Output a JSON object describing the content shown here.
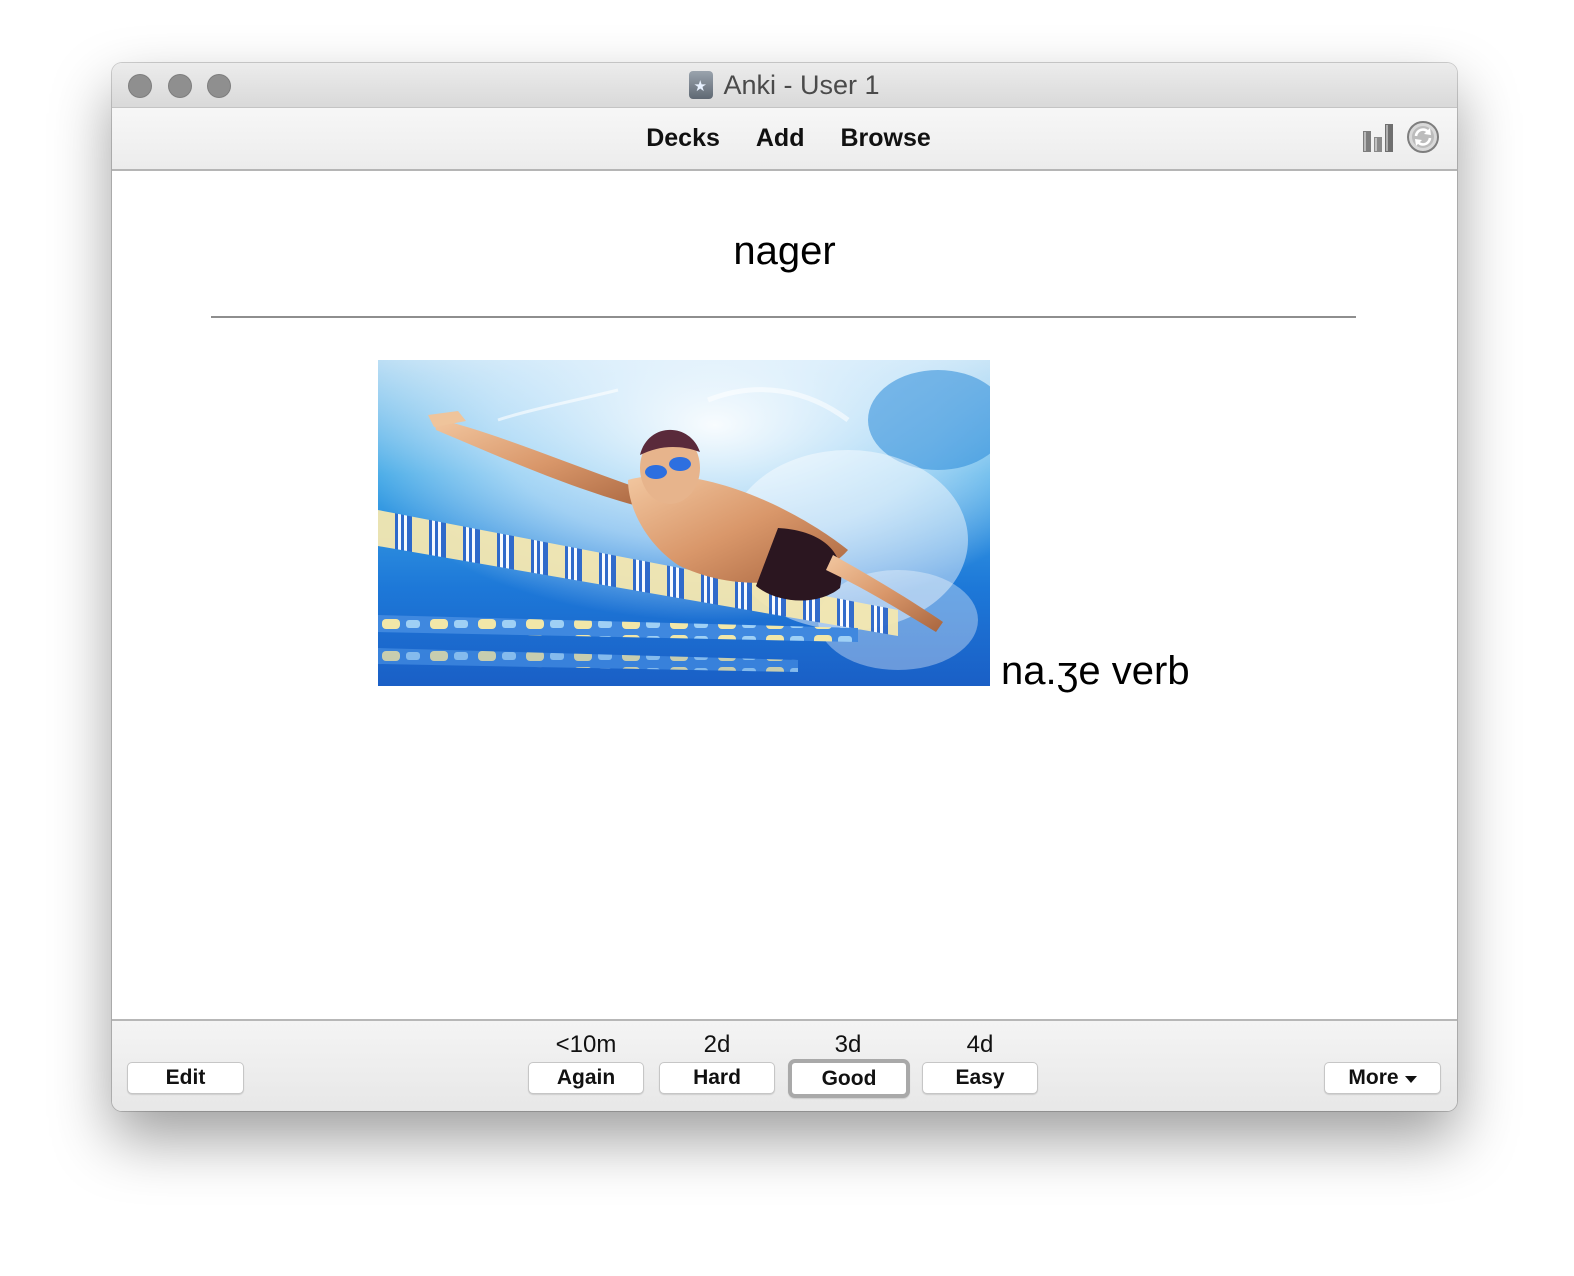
{
  "window": {
    "title": "Anki - User 1"
  },
  "toolbar": {
    "links": {
      "decks": "Decks",
      "add": "Add",
      "browse": "Browse"
    },
    "stats_icon": "stats-bar-chart-icon",
    "sync_icon": "sync-circular-arrows-icon"
  },
  "card": {
    "front": "nager",
    "back_text": "na.ʒe verb",
    "image_subject": "swimmer-freestyle-underwater-photo"
  },
  "bottombar": {
    "edit_label": "Edit",
    "answers": [
      {
        "interval": "<10m",
        "label": "Again"
      },
      {
        "interval": "2d",
        "label": "Hard"
      },
      {
        "interval": "3d",
        "label": "Good"
      },
      {
        "interval": "4d",
        "label": "Easy"
      }
    ],
    "default_answer": "Good",
    "more_label": "More"
  },
  "colors": {
    "titlebar": "#e2e2e2",
    "traffic_light_inactive": "#8f8f8f",
    "default_button_ring": "#a9a9a9"
  }
}
